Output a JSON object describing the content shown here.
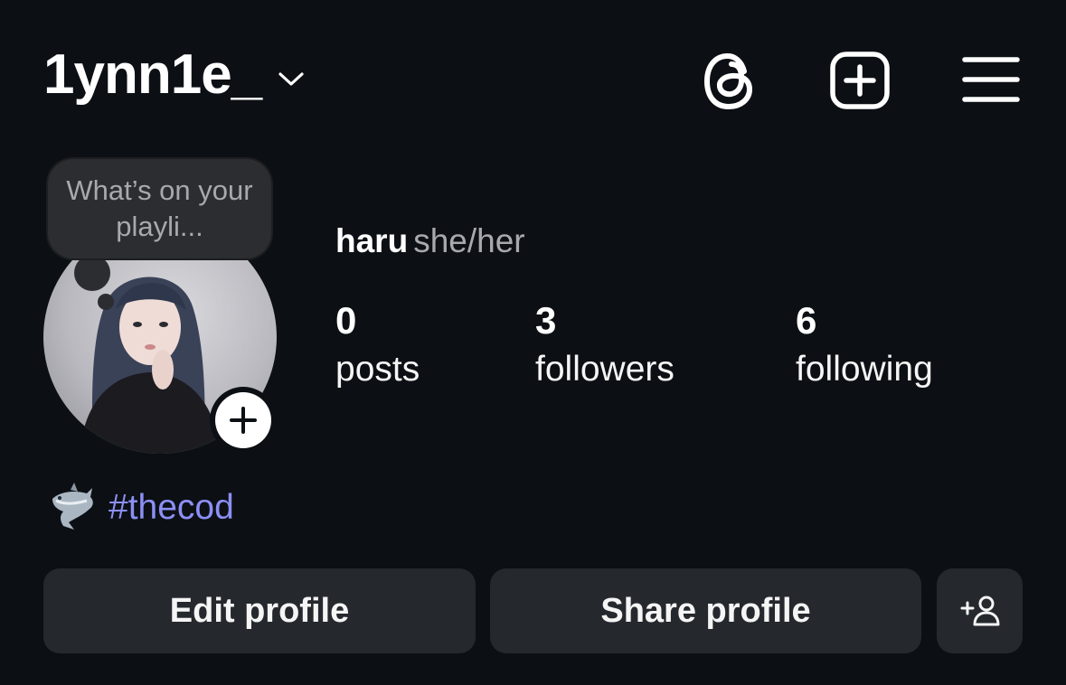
{
  "header": {
    "username": "1ynn1e_",
    "icons": [
      "chevron-down-icon",
      "threads-icon",
      "create-icon",
      "menu-icon"
    ]
  },
  "profile": {
    "note": "What’s on your playli...",
    "name": "haru",
    "pronouns": "she/her",
    "stats": {
      "posts": {
        "value": "0",
        "label": "posts"
      },
      "followers": {
        "value": "3",
        "label": "followers"
      },
      "following": {
        "value": "6",
        "label": "following"
      }
    },
    "bio": {
      "emoji_icon": "shark-icon",
      "hashtag": "#thecod"
    }
  },
  "actions": {
    "edit_label": "Edit profile",
    "share_label": "Share profile",
    "add_icon": "add-person-icon"
  },
  "colors": {
    "background": "#0c1014",
    "button": "#25292e",
    "hashtag": "#8c8ff5",
    "secondary_text": "#a8a8ad"
  }
}
